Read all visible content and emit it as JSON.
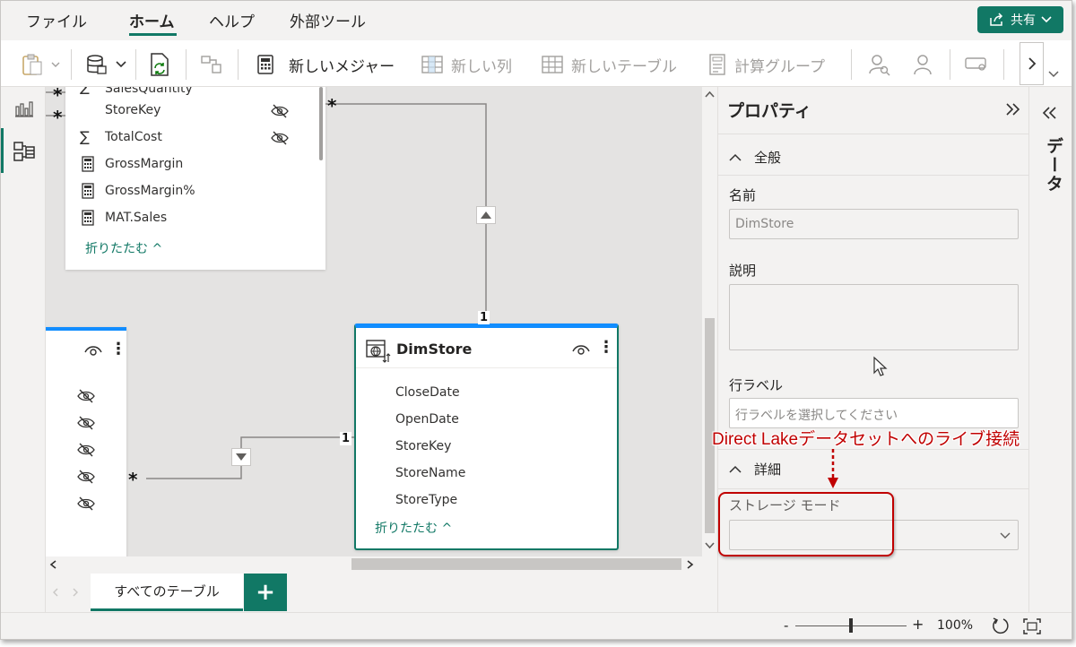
{
  "menu": {
    "items": [
      "ファイル",
      "ホーム",
      "ヘルプ",
      "外部ツール"
    ],
    "active": "ホーム",
    "share_label": "共有"
  },
  "ribbon": {
    "new_measure": "新しいメジャー",
    "new_column": "新しい列",
    "new_table": "新しいテーブル",
    "calc_group": "計算グループ"
  },
  "canvas": {
    "top_table": {
      "partial_field": "SalesQuantity",
      "fields": [
        {
          "name": "StoreKey",
          "icon": "none",
          "hidden": true
        },
        {
          "name": "TotalCost",
          "icon": "sigma",
          "hidden": true
        },
        {
          "name": "GrossMargin",
          "icon": "calculator",
          "hidden": false
        },
        {
          "name": "GrossMargin%",
          "icon": "calculator",
          "hidden": false
        },
        {
          "name": "MAT.Sales",
          "icon": "calculator",
          "hidden": false
        }
      ],
      "collapse": "折りたたむ ^"
    },
    "dimstore": {
      "title": "DimStore",
      "fields": [
        "CloseDate",
        "OpenDate",
        "StoreKey",
        "StoreName",
        "StoreType"
      ],
      "collapse": "折りたたむ ^"
    },
    "relation_many": "*",
    "relation_one": "1"
  },
  "tabs": {
    "all_tables": "すべてのテーブル",
    "add": "+"
  },
  "properties": {
    "title": "プロパティ",
    "general": "全般",
    "name_label": "名前",
    "name_value": "DimStore",
    "description_label": "説明",
    "row_label_label": "行ラベル",
    "row_label_placeholder": "行ラベルを選択してください",
    "details": "詳細",
    "storage_mode_label": "ストレージ モード",
    "data_pane": "データ"
  },
  "status": {
    "zoom": "100%",
    "minus": "-",
    "plus": "+",
    "zoom_fraction": 0.5
  },
  "annotation": {
    "text": "Direct Lakeデータセットへのライブ接続",
    "color": "#c00000"
  },
  "colors": {
    "accent": "#117865",
    "header_blue": "#118dff"
  }
}
